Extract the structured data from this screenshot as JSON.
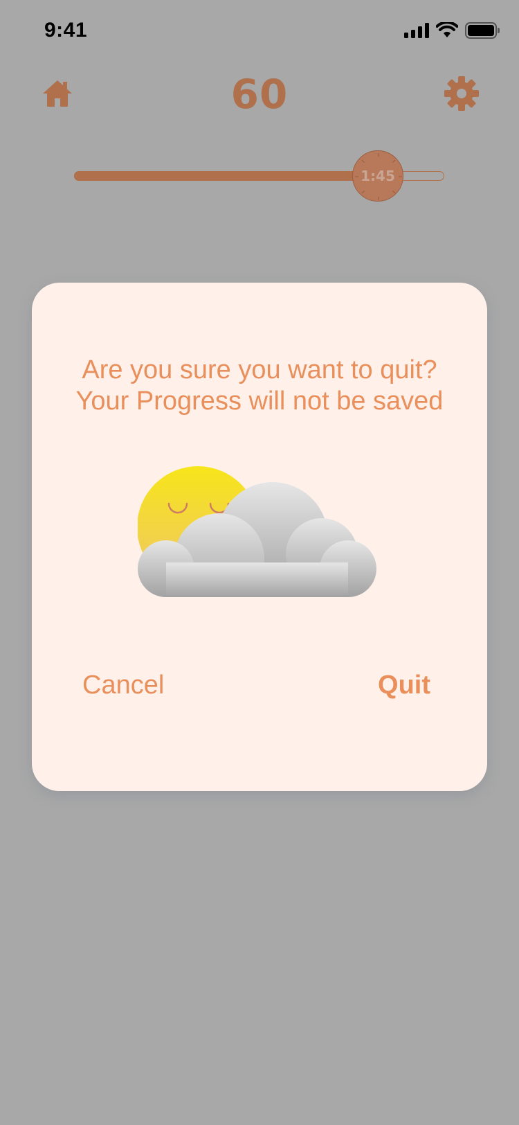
{
  "status_bar": {
    "time": "9:41"
  },
  "header": {
    "score": "60",
    "icons": [
      "home-icon",
      "gear-icon"
    ]
  },
  "timer_slider": {
    "label": "1:45",
    "progress": 0.82
  },
  "dialog": {
    "message_line1": "Are you sure you want to quit?",
    "message_line2": "Your Progress will not be saved",
    "illustration": "sleepy-sun-behind-cloud",
    "cancel_label": "Cancel",
    "quit_label": "Quit"
  },
  "colors": {
    "overlay_background": "#a8a8a8",
    "header_accent": "#b0704b",
    "dialog_background": "#fff1ea",
    "dialog_text": "#e88f5c"
  }
}
